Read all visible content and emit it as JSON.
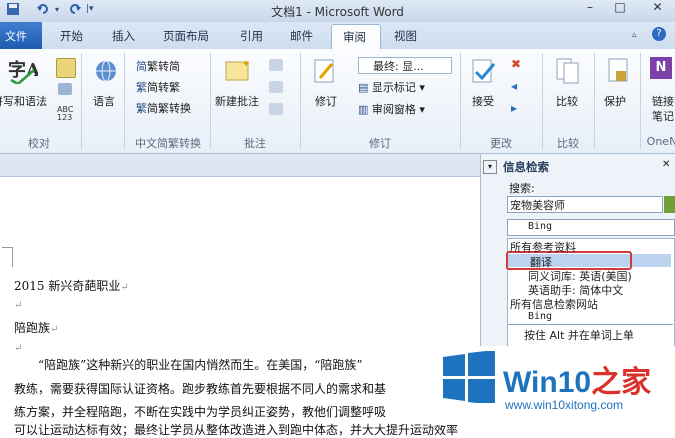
{
  "window": {
    "title": "文档1 - Microsoft Word",
    "controls": [
      "–",
      "□",
      "✕"
    ]
  },
  "tabs": [
    "文件",
    "开始",
    "插入",
    "页面布局",
    "引用",
    "邮件",
    "审阅",
    "视图"
  ],
  "ribbon": {
    "proof": {
      "btn1": "拼写和语法",
      "label": "校对"
    },
    "lang": {
      "btn": "语言"
    },
    "chinese": {
      "b1": "繁转简",
      "b2": "简转繁",
      "b3": "简繁转换",
      "label": "中文简繁转换"
    },
    "comments": {
      "btn": "新建批注",
      "label": "批注"
    },
    "tracking": {
      "btn": "修订",
      "dropdown": "最终: 显...",
      "show": "显示标记 ▾",
      "pane": "审阅窗格 ▾",
      "label": "修订"
    },
    "changes": {
      "btn": "接受",
      "label": "更改"
    },
    "compare": {
      "btn": "比较",
      "label": "比较"
    },
    "protect": {
      "btn": "保护"
    },
    "onenote": {
      "btn1": "链接",
      "btn2": "笔记",
      "label": "OneN"
    }
  },
  "document": {
    "lines": [
      "2015 新兴奇葩职业",
      "",
      "陪跑族",
      "",
      "“陪跑族”这种新兴的职业在国内悄然而生。在美国，“陪跑族”",
      "教练，需要获得国际认证资格。跑步教练首先要根据不同人的需求和基",
      "练方案，并全程陪跑，不断在实践中为学员纠正姿势，教他们调整呼吸",
      "可以让运动达标有效；最终让学员从整体改造进入到跑中体态，并大大提升运动效率"
    ],
    "para_mark": "↵"
  },
  "pane": {
    "title": "信息检索",
    "search_label": "搜索:",
    "search_value": "宠物美容师",
    "source": "Bing",
    "items": [
      "所有参考资料",
      "翻译",
      "同义词库: 英语(美国)",
      "英语助手: 简体中文",
      "所有信息检索网站",
      "Bing",
      "按住 Alt 并在单词上单"
    ]
  },
  "watermark": {
    "brand": "Win10",
    "brand2": "之家",
    "url": "www.win10xitong.com",
    "colors": {
      "blue": "#1e73be",
      "red": "#d8322b"
    }
  },
  "colors": {
    "file_tab": "#2a66be",
    "highlight": "#d33a3a"
  }
}
